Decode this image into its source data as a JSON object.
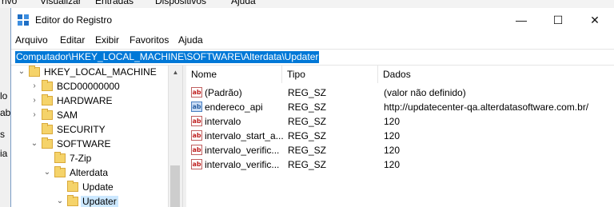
{
  "background_app": {
    "menu": [
      "rivo",
      "Visualizar",
      "Entradas",
      "Dispositivos",
      "Ajuda"
    ],
    "left_fragments": [
      "lo",
      "ab",
      "s",
      "ia"
    ]
  },
  "window": {
    "title": "Editor do Registro",
    "controls": {
      "minimize": "—",
      "maximize": "☐",
      "close": "✕"
    }
  },
  "menubar": [
    "Arquivo",
    "Editar",
    "Exibir",
    "Favoritos",
    "Ajuda"
  ],
  "address": "Computador\\HKEY_LOCAL_MACHINE\\SOFTWARE\\Alterdata\\Updater",
  "tree": [
    {
      "label": "HKEY_LOCAL_MACHINE",
      "expander": "⌄",
      "selected": false
    },
    {
      "label": "BCD00000000",
      "expander": "›",
      "selected": false
    },
    {
      "label": "HARDWARE",
      "expander": "›",
      "selected": false
    },
    {
      "label": "SAM",
      "expander": "›",
      "selected": false
    },
    {
      "label": "SECURITY",
      "expander": "",
      "selected": false
    },
    {
      "label": "SOFTWARE",
      "expander": "⌄",
      "selected": false
    },
    {
      "label": "7-Zip",
      "expander": "",
      "selected": false
    },
    {
      "label": "Alterdata",
      "expander": "⌄",
      "selected": false
    },
    {
      "label": "Update",
      "expander": "",
      "selected": false
    },
    {
      "label": "Updater",
      "expander": "⌄",
      "selected": true
    }
  ],
  "columns": {
    "name": "Nome",
    "type": "Tipo",
    "data": "Dados"
  },
  "values": [
    {
      "name": "(Padrão)",
      "type": "REG_SZ",
      "data": "(valor não definido)",
      "icon": "ab"
    },
    {
      "name": "endereco_api",
      "type": "REG_SZ",
      "data": "http://updatecenter-qa.alterdatasoftware.com.br/",
      "icon": "ab",
      "icon_selected": true
    },
    {
      "name": "intervalo",
      "type": "REG_SZ",
      "data": "120",
      "icon": "ab"
    },
    {
      "name": "intervalo_start_a...",
      "type": "REG_SZ",
      "data": "120",
      "icon": "ab"
    },
    {
      "name": "intervalo_verific...",
      "type": "REG_SZ",
      "data": "120",
      "icon": "ab"
    },
    {
      "name": "intervalo_verific...",
      "type": "REG_SZ",
      "data": "120",
      "icon": "ab"
    }
  ],
  "scroll_up_glyph": "▲"
}
